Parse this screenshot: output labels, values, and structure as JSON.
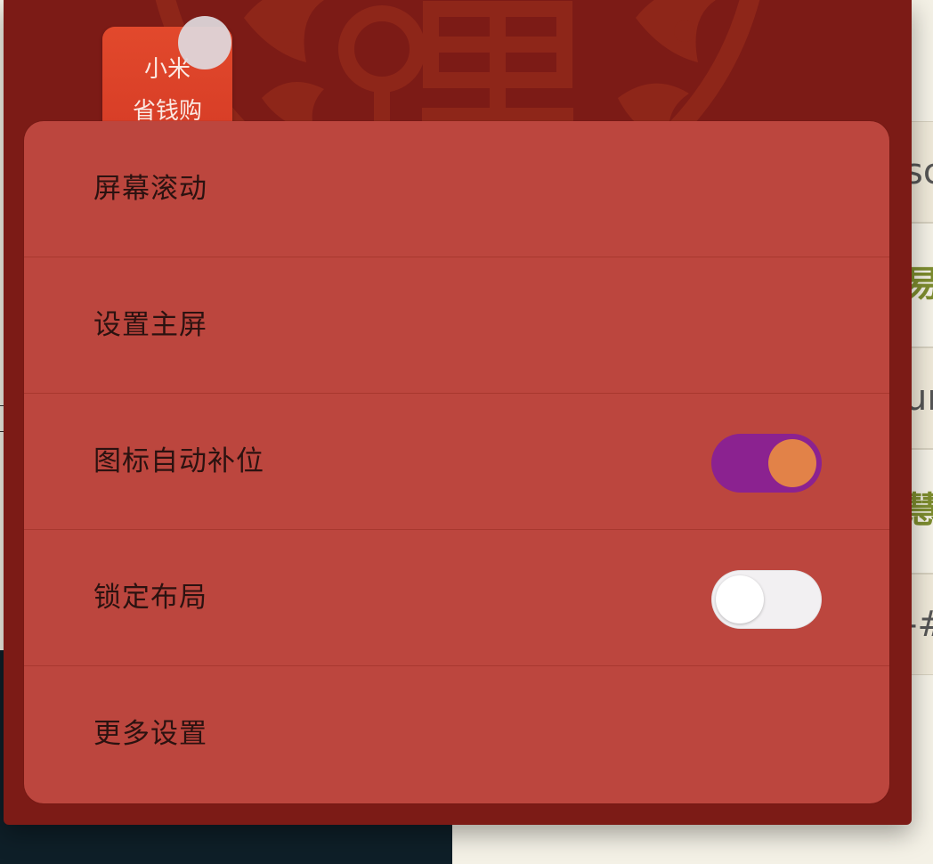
{
  "app_icon": {
    "line1": "小米",
    "line2": "省钱购",
    "icon": "shopping-app-icon"
  },
  "menu": {
    "items": [
      {
        "label": "屏幕滚动"
      },
      {
        "label": "设置主屏"
      },
      {
        "label": "图标自动补位",
        "toggle": true
      },
      {
        "label": "锁定布局",
        "toggle": false
      },
      {
        "label": "更多设置"
      }
    ]
  },
  "background_doc": {
    "rows": [
      "sc",
      "易",
      "ur",
      "慧",
      "-#"
    ]
  },
  "colors": {
    "panel": "#bc463e",
    "launcher": "#7c1b16",
    "toggle_on_track": "#8b2290",
    "toggle_on_knob": "#e28248",
    "toggle_off_track": "#f2f0f2"
  }
}
